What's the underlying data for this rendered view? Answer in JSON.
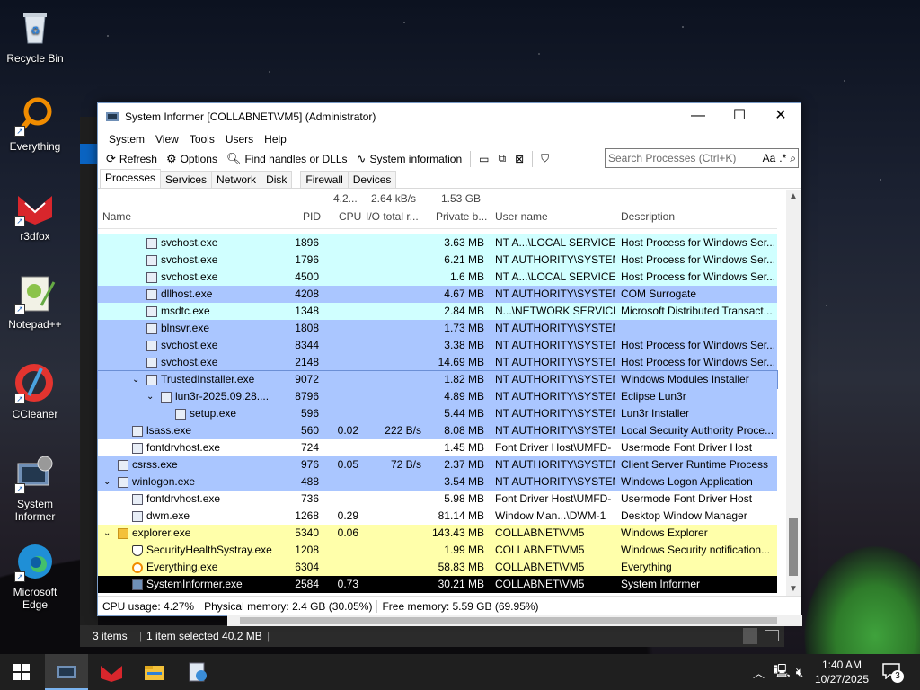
{
  "desktop": {
    "icons": [
      {
        "label": "Recycle Bin",
        "icon": "recycle-bin-icon"
      },
      {
        "label": "Everything",
        "icon": "everything-icon"
      },
      {
        "label": "r3dfox",
        "icon": "r3dfox-icon"
      },
      {
        "label": "Notepad++",
        "icon": "notepadpp-icon"
      },
      {
        "label": "CCleaner",
        "icon": "ccleaner-icon"
      },
      {
        "label": "System Informer",
        "icon": "system-informer-icon"
      },
      {
        "label": "Microsoft Edge",
        "icon": "edge-icon"
      }
    ]
  },
  "window": {
    "title": "System Informer [COLLABNET\\VM5] (Administrator)",
    "menu": [
      "System",
      "View",
      "Tools",
      "Users",
      "Help"
    ],
    "toolbar": {
      "refresh": "Refresh",
      "options": "Options",
      "find": "Find handles or DLLs",
      "sysinfo": "System information"
    },
    "search": {
      "placeholder": "Search Processes (Ctrl+K)",
      "aa": "Aa",
      "regex": ".*"
    },
    "tabs": [
      "Processes",
      "Services",
      "Network",
      "Disk",
      "Firewall",
      "Devices"
    ],
    "summary": {
      "cpu": "4.2...",
      "io": "2.64 kB/s",
      "private": "1.53 GB"
    },
    "columns": {
      "name": "Name",
      "pid": "PID",
      "cpu": "CPU",
      "io": "I/O total r...",
      "private": "Private b...",
      "user": "User name",
      "desc": "Description"
    },
    "rows": [
      {
        "name": "svchost.exe",
        "pid": "1896",
        "cpu": "",
        "io": "",
        "private": "3.63 MB",
        "user": "NT A...\\LOCAL SERVICE",
        "desc": "Host Process for Windows Ser..."
      },
      {
        "name": "svchost.exe",
        "pid": "1796",
        "cpu": "",
        "io": "",
        "private": "6.21 MB",
        "user": "NT AUTHORITY\\SYSTEM",
        "desc": "Host Process for Windows Ser..."
      },
      {
        "name": "svchost.exe",
        "pid": "4500",
        "cpu": "",
        "io": "",
        "private": "1.6 MB",
        "user": "NT A...\\LOCAL SERVICE",
        "desc": "Host Process for Windows Ser..."
      },
      {
        "name": "dllhost.exe",
        "pid": "4208",
        "cpu": "",
        "io": "",
        "private": "4.67 MB",
        "user": "NT AUTHORITY\\SYSTEM",
        "desc": "COM Surrogate"
      },
      {
        "name": "msdtc.exe",
        "pid": "1348",
        "cpu": "",
        "io": "",
        "private": "2.84 MB",
        "user": "N...\\NETWORK SERVICE",
        "desc": "Microsoft Distributed Transact..."
      },
      {
        "name": "blnsvr.exe",
        "pid": "1808",
        "cpu": "",
        "io": "",
        "private": "1.73 MB",
        "user": "NT AUTHORITY\\SYSTEM",
        "desc": ""
      },
      {
        "name": "svchost.exe",
        "pid": "8344",
        "cpu": "",
        "io": "",
        "private": "3.38 MB",
        "user": "NT AUTHORITY\\SYSTEM",
        "desc": "Host Process for Windows Ser..."
      },
      {
        "name": "svchost.exe",
        "pid": "2148",
        "cpu": "",
        "io": "",
        "private": "14.69 MB",
        "user": "NT AUTHORITY\\SYSTEM",
        "desc": "Host Process for Windows Ser..."
      },
      {
        "name": "TrustedInstaller.exe",
        "pid": "9072",
        "cpu": "",
        "io": "",
        "private": "1.82 MB",
        "user": "NT AUTHORITY\\SYSTEM",
        "desc": "Windows Modules Installer"
      },
      {
        "name": "lun3r-2025.09.28....",
        "pid": "8796",
        "cpu": "",
        "io": "",
        "private": "4.89 MB",
        "user": "NT AUTHORITY\\SYSTEM",
        "desc": "Eclipse Lun3r"
      },
      {
        "name": "setup.exe",
        "pid": "596",
        "cpu": "",
        "io": "",
        "private": "5.44 MB",
        "user": "NT AUTHORITY\\SYSTEM",
        "desc": "Lun3r Installer"
      },
      {
        "name": "lsass.exe",
        "pid": "560",
        "cpu": "0.02",
        "io": "222 B/s",
        "private": "8.08 MB",
        "user": "NT AUTHORITY\\SYSTEM",
        "desc": "Local Security Authority Proce..."
      },
      {
        "name": "fontdrvhost.exe",
        "pid": "724",
        "cpu": "",
        "io": "",
        "private": "1.45 MB",
        "user": "Font Driver Host\\UMFD-",
        "desc": "Usermode Font Driver Host"
      },
      {
        "name": "csrss.exe",
        "pid": "976",
        "cpu": "0.05",
        "io": "72 B/s",
        "private": "2.37 MB",
        "user": "NT AUTHORITY\\SYSTEM",
        "desc": "Client Server Runtime Process"
      },
      {
        "name": "winlogon.exe",
        "pid": "488",
        "cpu": "",
        "io": "",
        "private": "3.54 MB",
        "user": "NT AUTHORITY\\SYSTEM",
        "desc": "Windows Logon Application"
      },
      {
        "name": "fontdrvhost.exe",
        "pid": "736",
        "cpu": "",
        "io": "",
        "private": "5.98 MB",
        "user": "Font Driver Host\\UMFD-",
        "desc": "Usermode Font Driver Host"
      },
      {
        "name": "dwm.exe",
        "pid": "1268",
        "cpu": "0.29",
        "io": "",
        "private": "81.14 MB",
        "user": "Window Man...\\DWM-1",
        "desc": "Desktop Window Manager"
      },
      {
        "name": "explorer.exe",
        "pid": "5340",
        "cpu": "0.06",
        "io": "",
        "private": "143.43 MB",
        "user": "COLLABNET\\VM5",
        "desc": "Windows Explorer"
      },
      {
        "name": "SecurityHealthSystray.exe",
        "pid": "1208",
        "cpu": "",
        "io": "",
        "private": "1.99 MB",
        "user": "COLLABNET\\VM5",
        "desc": "Windows Security notification..."
      },
      {
        "name": "Everything.exe",
        "pid": "6304",
        "cpu": "",
        "io": "",
        "private": "58.83 MB",
        "user": "COLLABNET\\VM5",
        "desc": "Everything"
      },
      {
        "name": "SystemInformer.exe",
        "pid": "2584",
        "cpu": "0.73",
        "io": "",
        "private": "30.21 MB",
        "user": "COLLABNET\\VM5",
        "desc": "System Informer"
      }
    ],
    "status": {
      "cpu": "CPU usage: 4.27%",
      "phys": "Physical memory: 2.4 GB (30.05%)",
      "free": "Free memory: 5.59 GB (69.95%)"
    }
  },
  "explorer_status": {
    "items": "3 items",
    "selected": "1 item selected  40.2 MB"
  },
  "taskbar": {
    "time": "1:40 AM",
    "date": "10/27/2025",
    "notifications": "3"
  },
  "colors": {
    "service": "#d0ffff",
    "system": "#aac6ff",
    "system_selected": "#aac6ff",
    "user": "#ffffaa",
    "selected": "#000000"
  }
}
